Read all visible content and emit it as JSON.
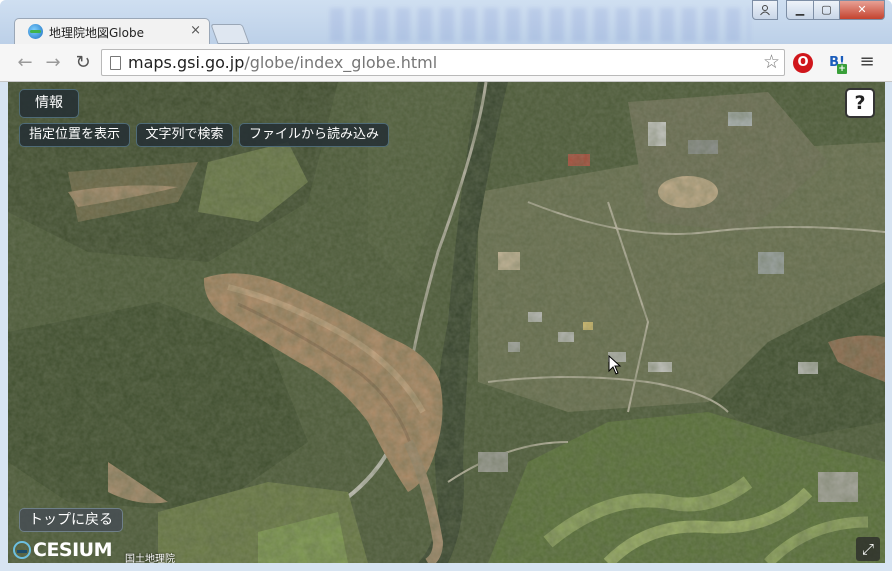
{
  "browser": {
    "tab_title": "地理院地図Globe",
    "tab_close": "×",
    "url_host": "maps.gsi.go.jp",
    "url_path": "/globe/index_globe.html",
    "window_buttons": {
      "minimize": "▁",
      "maximize": "▢",
      "close": "✕"
    },
    "nav": {
      "back": "←",
      "forward": "→",
      "reload": "↻"
    },
    "bookmark_icon": "star-icon",
    "extensions": [
      {
        "name": "opera-extension-icon",
        "glyph": "O"
      },
      {
        "name": "hatena-bookmark-icon",
        "glyph": "B!",
        "badge": "+"
      }
    ],
    "menu_glyph": "≡"
  },
  "map_ui": {
    "info_label": "情報",
    "show_location_label": "指定位置を表示",
    "text_search_label": "文字列で検索",
    "load_file_label": "ファイルから読み込み",
    "help_label": "?",
    "back_to_top_label": "トップに戻る",
    "fullscreen_glyph": "⤢",
    "logo_text": "CESIUM",
    "attribution": "国土地理院"
  },
  "colors": {
    "button_bg": "#263034",
    "button_border": "#4f6b77",
    "map_forest": "#4b5a38",
    "landslide": "#b8926d"
  }
}
